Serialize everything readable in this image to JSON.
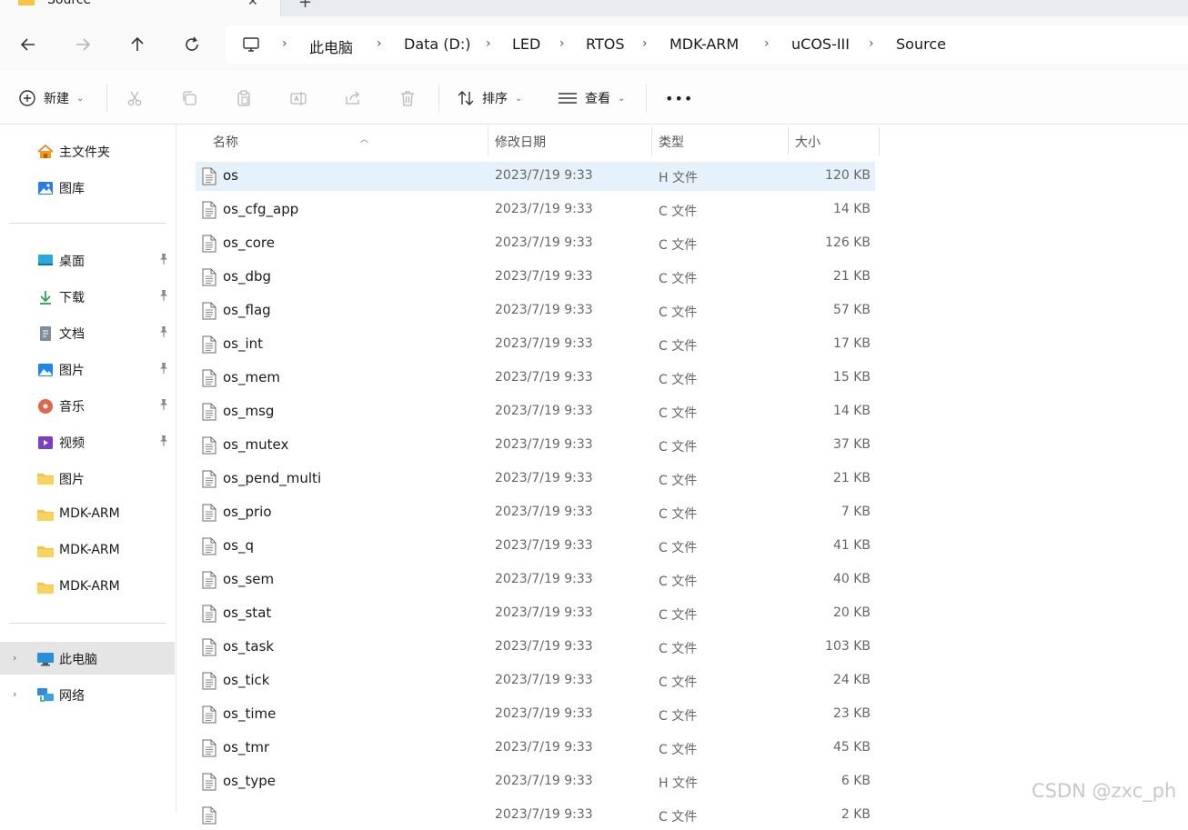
{
  "window": {
    "tab_title": "Source",
    "new_tab": "+",
    "close": "✕"
  },
  "nav": {
    "back": "←",
    "forward": "→",
    "up": "↑",
    "refresh": "↻"
  },
  "breadcrumb": [
    "此电脑",
    "Data (D:)",
    "LED",
    "RTOS",
    "MDK-ARM",
    "uCOS-III",
    "Source"
  ],
  "breadcrumb_separator": "›",
  "toolbar": {
    "new_label": "新建",
    "sort_label": "排序",
    "view_label": "查看",
    "more_label": "•••",
    "icons": [
      "plus-circle-icon",
      "cut-icon",
      "copy-icon",
      "paste-icon",
      "rename-icon",
      "share-icon",
      "delete-icon",
      "sort-icon",
      "view-icon",
      "more-icon"
    ]
  },
  "sidebar": {
    "quick": [
      {
        "label": "主文件夹",
        "icon": "home-icon"
      },
      {
        "label": "图库",
        "icon": "gallery-icon"
      }
    ],
    "pinned": [
      {
        "label": "桌面",
        "icon": "desktop-icon",
        "pinned": true
      },
      {
        "label": "下载",
        "icon": "download-icon",
        "pinned": true
      },
      {
        "label": "文档",
        "icon": "document-icon",
        "pinned": true
      },
      {
        "label": "图片",
        "icon": "pictures-icon",
        "pinned": true
      },
      {
        "label": "音乐",
        "icon": "music-icon",
        "pinned": true
      },
      {
        "label": "视频",
        "icon": "video-icon",
        "pinned": true
      },
      {
        "label": "图片",
        "icon": "folder-icon",
        "pinned": false
      },
      {
        "label": "MDK-ARM",
        "icon": "folder-icon",
        "pinned": false
      },
      {
        "label": "MDK-ARM",
        "icon": "folder-icon",
        "pinned": false
      },
      {
        "label": "MDK-ARM",
        "icon": "folder-icon",
        "pinned": false
      }
    ],
    "devices": [
      {
        "label": "此电脑",
        "icon": "this-pc-icon",
        "selected": true
      },
      {
        "label": "网络",
        "icon": "network-icon",
        "selected": false
      }
    ]
  },
  "columns": {
    "name": "名称",
    "modified": "修改日期",
    "type": "类型",
    "size": "大小"
  },
  "files": [
    {
      "name": "os",
      "modified": "2023/7/19 9:33",
      "type": "H 文件",
      "size": "120 KB",
      "selected": true
    },
    {
      "name": "os_cfg_app",
      "modified": "2023/7/19 9:33",
      "type": "C 文件",
      "size": "14 KB"
    },
    {
      "name": "os_core",
      "modified": "2023/7/19 9:33",
      "type": "C 文件",
      "size": "126 KB"
    },
    {
      "name": "os_dbg",
      "modified": "2023/7/19 9:33",
      "type": "C 文件",
      "size": "21 KB"
    },
    {
      "name": "os_flag",
      "modified": "2023/7/19 9:33",
      "type": "C 文件",
      "size": "57 KB"
    },
    {
      "name": "os_int",
      "modified": "2023/7/19 9:33",
      "type": "C 文件",
      "size": "17 KB"
    },
    {
      "name": "os_mem",
      "modified": "2023/7/19 9:33",
      "type": "C 文件",
      "size": "15 KB"
    },
    {
      "name": "os_msg",
      "modified": "2023/7/19 9:33",
      "type": "C 文件",
      "size": "14 KB"
    },
    {
      "name": "os_mutex",
      "modified": "2023/7/19 9:33",
      "type": "C 文件",
      "size": "37 KB"
    },
    {
      "name": "os_pend_multi",
      "modified": "2023/7/19 9:33",
      "type": "C 文件",
      "size": "21 KB"
    },
    {
      "name": "os_prio",
      "modified": "2023/7/19 9:33",
      "type": "C 文件",
      "size": "7 KB"
    },
    {
      "name": "os_q",
      "modified": "2023/7/19 9:33",
      "type": "C 文件",
      "size": "41 KB"
    },
    {
      "name": "os_sem",
      "modified": "2023/7/19 9:33",
      "type": "C 文件",
      "size": "40 KB"
    },
    {
      "name": "os_stat",
      "modified": "2023/7/19 9:33",
      "type": "C 文件",
      "size": "20 KB"
    },
    {
      "name": "os_task",
      "modified": "2023/7/19 9:33",
      "type": "C 文件",
      "size": "103 KB"
    },
    {
      "name": "os_tick",
      "modified": "2023/7/19 9:33",
      "type": "C 文件",
      "size": "24 KB"
    },
    {
      "name": "os_time",
      "modified": "2023/7/19 9:33",
      "type": "C 文件",
      "size": "23 KB"
    },
    {
      "name": "os_tmr",
      "modified": "2023/7/19 9:33",
      "type": "C 文件",
      "size": "45 KB"
    },
    {
      "name": "os_type",
      "modified": "2023/7/19 9:33",
      "type": "H 文件",
      "size": "6 KB"
    },
    {
      "name": "",
      "modified": "2023/7/19 9:33",
      "type": "C 文件",
      "size": "2 KB"
    }
  ],
  "watermark": "CSDN @zxc_ph",
  "colors": {
    "selection": "#e5f1fb",
    "sidebar_selected": "#e5e5e5",
    "chrome": "#f9f9f9",
    "folder": "#f4c542"
  }
}
